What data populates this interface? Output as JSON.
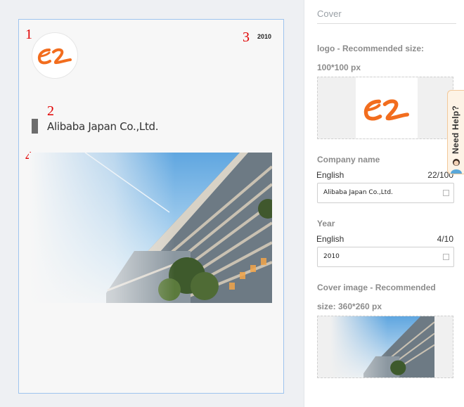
{
  "preview": {
    "markers": [
      "1",
      "2",
      "3",
      "4"
    ],
    "year": "2010",
    "company_name": "Alibaba Japan Co.,Ltd.",
    "logo_icon": "alibaba-logo-icon",
    "cover_icon": "building-photo"
  },
  "panel": {
    "title": "Cover",
    "logo_label": "logo - Recommended size:",
    "logo_size": "100*100 px",
    "company_label": "Company name",
    "company_lang": "English",
    "company_counter": "22/100",
    "company_value": "Alibaba Japan Co.,Ltd.",
    "year_label": "Year",
    "year_lang": "English",
    "year_counter": "4/10",
    "year_value": "2010",
    "cover_label": "Cover image - Recommended",
    "cover_size": "size: 360*260 px"
  },
  "help": {
    "label": "Need Help?"
  },
  "colors": {
    "marker": "#e10000",
    "logo_orange": "#f26d1e",
    "preview_border": "#9ec4ee",
    "help_border": "#f2c89a"
  }
}
